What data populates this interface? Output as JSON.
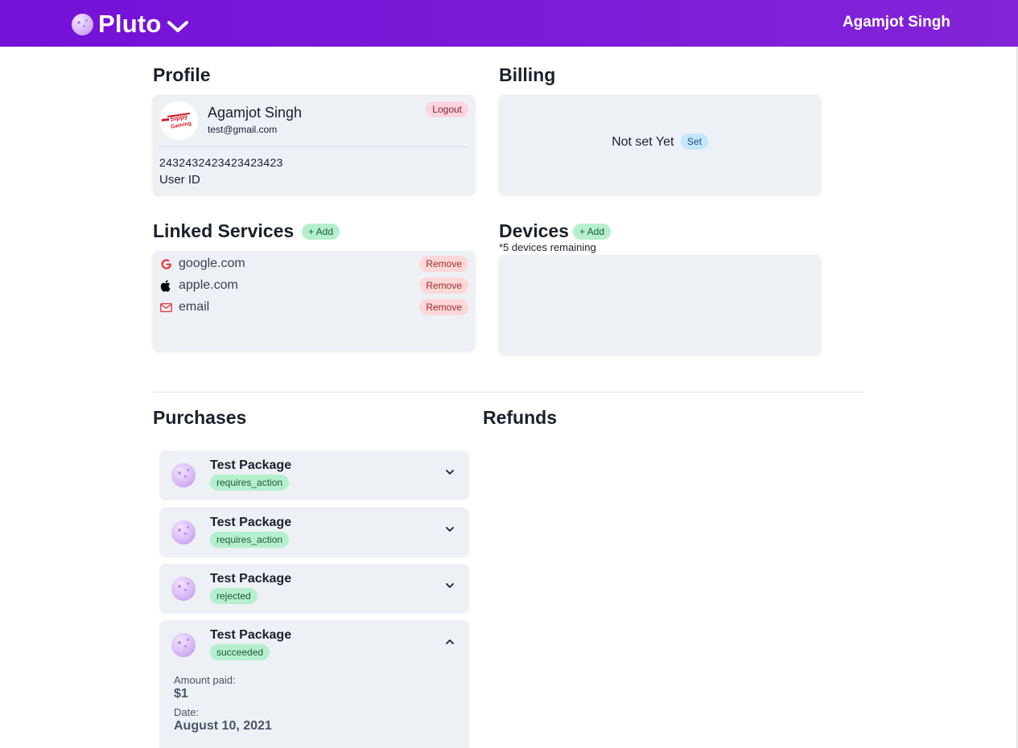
{
  "header": {
    "brand": "Pluto",
    "user_name": "Agamjot Singh"
  },
  "profile": {
    "title": "Profile",
    "name": "Agamjot Singh",
    "email": "test@gmail.com",
    "logout_label": "Logout",
    "user_id_value": "2432432423423423423",
    "user_id_label": "User ID"
  },
  "billing": {
    "title": "Billing",
    "status_text": "Not set Yet",
    "set_label": "Set"
  },
  "linked_services": {
    "title": "Linked Services",
    "add_label": "+ Add",
    "items": [
      {
        "label": "google.com",
        "icon": "google-icon",
        "remove_label": "Remove"
      },
      {
        "label": "apple.com",
        "icon": "apple-icon",
        "remove_label": "Remove"
      },
      {
        "label": "email",
        "icon": "mail-icon",
        "remove_label": "Remove"
      }
    ]
  },
  "devices": {
    "title": "Devices",
    "add_label": "+ Add",
    "remaining": "*5 devices remaining"
  },
  "purchases": {
    "title": "Purchases",
    "items": [
      {
        "name": "Test Package",
        "status": "requires_action",
        "expanded": false
      },
      {
        "name": "Test Package",
        "status": "requires_action",
        "expanded": false
      },
      {
        "name": "Test Package",
        "status": "rejected",
        "expanded": false
      },
      {
        "name": "Test Package",
        "status": "succeeded",
        "expanded": true,
        "amount_label": "Amount paid:",
        "amount": "$1",
        "date_label": "Date:",
        "date": "August 10, 2021"
      }
    ]
  },
  "refunds": {
    "title": "Refunds"
  },
  "colors": {
    "brand_purple": "#7410d8",
    "card_bg": "#edf0f5",
    "status_green": "#b4f0cd",
    "remove_red": "#fed7d7"
  }
}
